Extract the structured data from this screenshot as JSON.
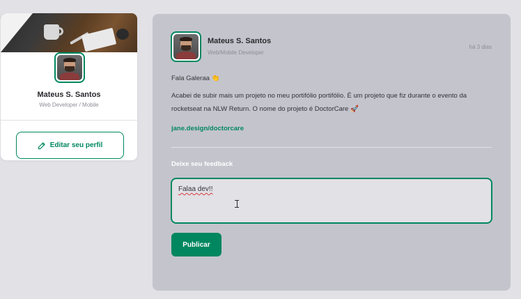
{
  "sidebar": {
    "name": "Mateus S. Santos",
    "role": "Web Developer / Mobile",
    "edit_button_label": "Editar seu perfil",
    "edit_icon": "pencil-icon"
  },
  "post": {
    "author": {
      "name": "Mateus S. Santos",
      "role": "Web/Mobile Developer"
    },
    "time": "há 3 dias",
    "content": {
      "paragraph1": "Fala Galeraa 👏",
      "paragraph2": "Acabei de subir mais um projeto no meu portifólio portifólio. É um projeto que fiz durante o evento da rocketseat na NLW Return. O nome do projeto é DoctorCare 🚀",
      "link": "jane.design/doctorcare"
    },
    "feedback": {
      "title": "Deixe seu feedback",
      "textarea_value": "Falaa dev!!"
    },
    "publish_label": "Publicar"
  },
  "colors": {
    "background": "#e1e1e6",
    "card": "#ffffff",
    "post_card": "#c4c4cc",
    "accent": "#00875f",
    "text_primary": "#29292e",
    "text_secondary": "#8d8d99"
  }
}
